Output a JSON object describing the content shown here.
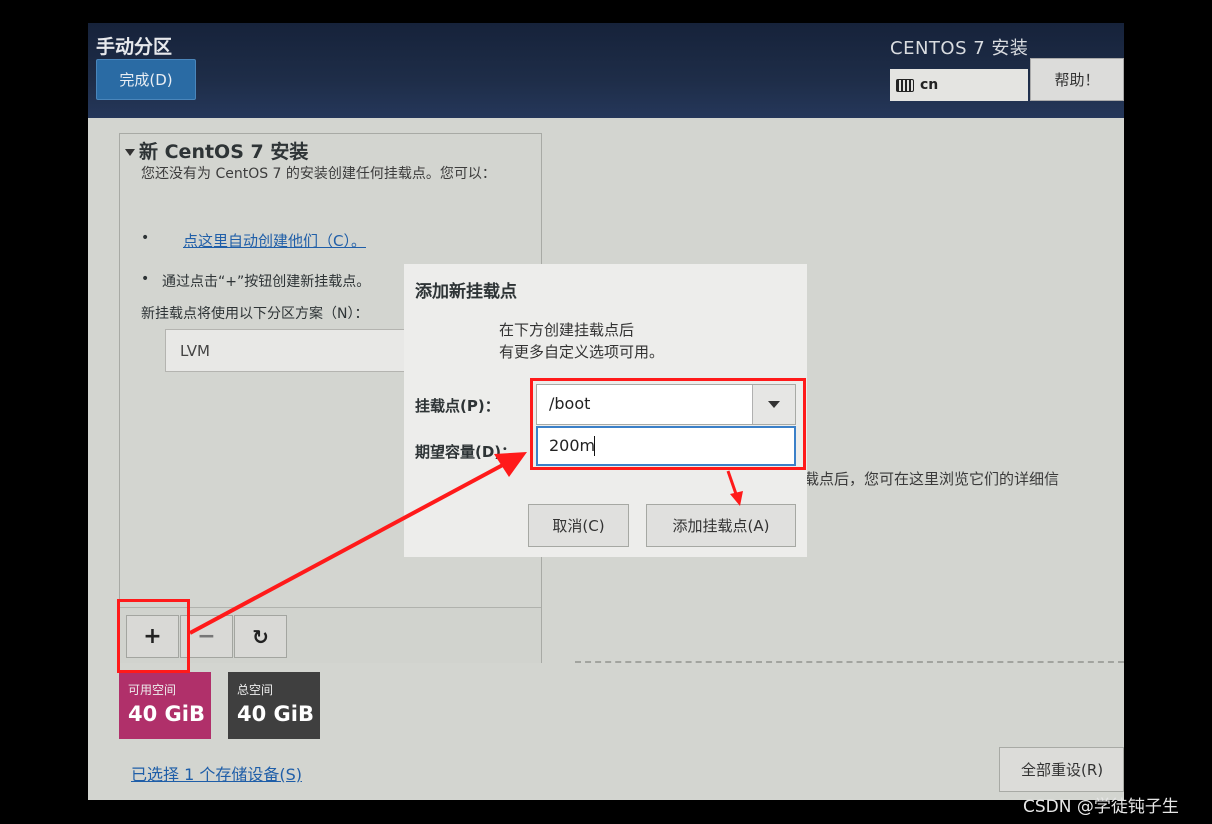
{
  "header": {
    "title": "手动分区",
    "done_label": "完成(D)",
    "os_title": "CENTOS 7 安装",
    "keyboard_layout": "cn",
    "help_label": "帮助！"
  },
  "left_panel": {
    "section_title": "新 CentOS 7 安装",
    "description": "您还没有为 CentOS 7 的安装创建任何挂载点。您可以：",
    "bullet_char": "•",
    "auto_create_link": "点这里自动创建他们（C）。",
    "manual_hint": "通过点击“+”按钮创建新挂载点。",
    "scheme_label": "新挂载点将使用以下分区方案（N）：",
    "scheme_value": "LVM",
    "toolbar": {
      "add": "+",
      "remove": "−",
      "refresh": "↻"
    }
  },
  "space": {
    "available_label": "可用空间",
    "available_value": "40 GiB",
    "total_label": "总空间",
    "total_value": "40 GiB",
    "available_color": "#b0306a",
    "total_color": "#3f3f3f"
  },
  "storage_link": "已选择 1 个存储设备(S)",
  "reset_label": "全部重设(R)",
  "right_note": "载点后，您可在这里浏览它们的详细信",
  "dialog": {
    "title": "添加新挂载点",
    "subtitle_line1": "在下方创建挂载点后",
    "subtitle_line2": "有更多自定义选项可用。",
    "mount_label": "挂载点(P)：",
    "mount_value": "/boot",
    "capacity_label": "期望容量(D)：",
    "capacity_value": "200m",
    "cancel_label": "取消(C)",
    "add_label": "添加挂载点(A)"
  },
  "annotation_color": "#ff1a1a",
  "watermark": "CSDN @学徒钝子生"
}
